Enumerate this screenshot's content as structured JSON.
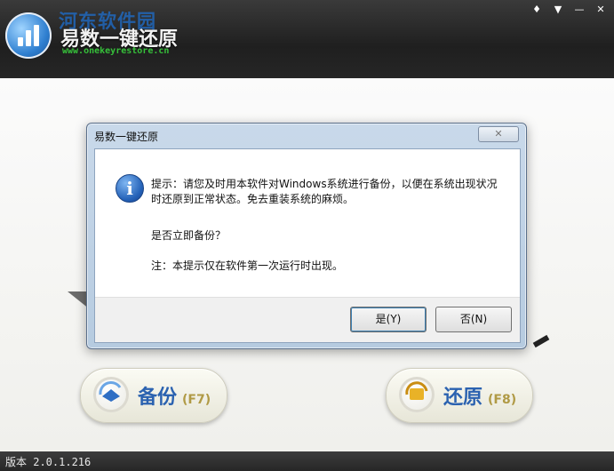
{
  "header": {
    "watermark": "河东软件园",
    "app_name": "易数一键还原",
    "app_url": "www.onekeyrestore.cn",
    "controls": [
      {
        "name": "skin-icon",
        "glyph": "♦"
      },
      {
        "name": "menu-icon",
        "glyph": "▼"
      },
      {
        "name": "minimize-icon",
        "glyph": "—"
      },
      {
        "name": "close-icon",
        "glyph": "✕"
      }
    ]
  },
  "main": {
    "backup_button": {
      "label": "备份",
      "key": "(F7)"
    },
    "restore_button": {
      "label": "还原",
      "key": "(F8)"
    }
  },
  "status": {
    "version": "版本 2.0.1.216"
  },
  "dialog": {
    "title": "易数一键还原",
    "close_glyph": "✕",
    "icon_glyph": "i",
    "message_line1": "提示：请您及时用本软件对Windows系统进行备份，以便在系统出现状况时还原到正常状态。免去重装系统的麻烦。",
    "message_line2": "是否立即备份？",
    "message_line3": "注：本提示仅在软件第一次运行时出现。",
    "yes_label": "是(Y)",
    "no_label": "否(N)"
  },
  "colors": {
    "accent": "#2b62b0",
    "url_green": "#36c13a",
    "header_dark": "#262626"
  }
}
